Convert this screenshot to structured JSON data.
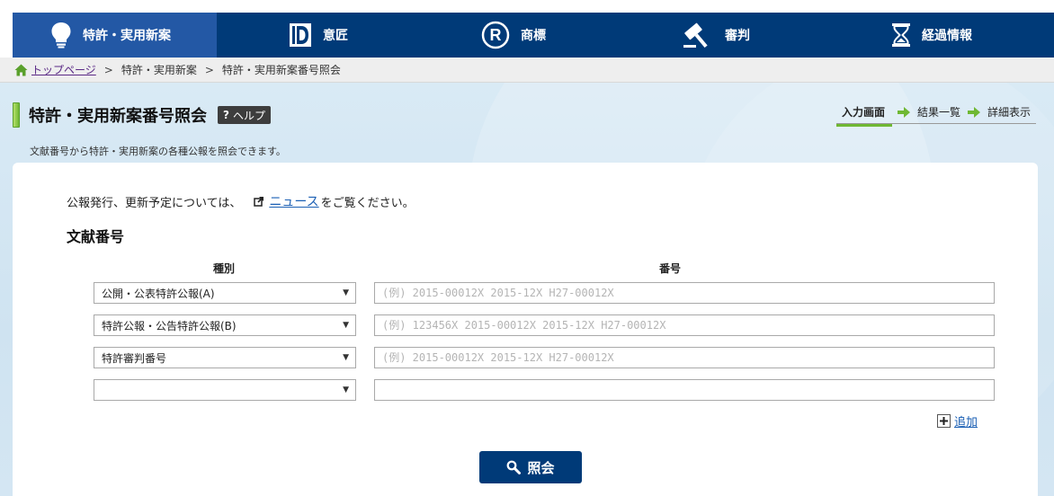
{
  "nav": {
    "items": [
      {
        "label": "特許・実用新案",
        "icon": "lightbulb-icon"
      },
      {
        "label": "意匠",
        "icon": "design-d-icon"
      },
      {
        "label": "商標",
        "icon": "registered-trademark-icon"
      },
      {
        "label": "審判",
        "icon": "gavel-icon"
      },
      {
        "label": "経過情報",
        "icon": "hourglass-icon"
      }
    ],
    "active_index": 0
  },
  "breadcrumb": {
    "home": "トップページ",
    "separator": ">",
    "items": [
      "特許・実用新案",
      "特許・実用新案番号照会"
    ]
  },
  "page": {
    "title": "特許・実用新案番号照会",
    "help_label": "ヘルプ",
    "help_q": "?",
    "description": "文献番号から特許・実用新案の各種公報を照会できます。"
  },
  "steps": {
    "items": [
      "入力画面",
      "結果一覧",
      "詳細表示"
    ],
    "current_index": 0
  },
  "notice": {
    "prefix": "公報発行、更新予定については、",
    "link": "ニュース",
    "suffix": "をご覧ください。"
  },
  "form": {
    "section_title": "文献番号",
    "col_type": "種別",
    "col_number": "番号",
    "rows": [
      {
        "type": "公開・公表特許公報(A)",
        "placeholder": "(例) 2015-00012X 2015-12X H27-00012X",
        "value": ""
      },
      {
        "type": "特許公報・公告特許公報(B)",
        "placeholder": "(例) 123456X 2015-00012X 2015-12X H27-00012X",
        "value": ""
      },
      {
        "type": "特許審判番号",
        "placeholder": "(例) 2015-00012X 2015-12X H27-00012X",
        "value": ""
      },
      {
        "type": "",
        "placeholder": "",
        "value": ""
      }
    ],
    "add_label": "追加",
    "submit_label": "照会"
  },
  "colors": {
    "nav_bg": "#003a78",
    "nav_active": "#2358a5",
    "accent_green": "#6fb833",
    "link": "#1a5fb4",
    "visited_link": "#5b2a86"
  }
}
